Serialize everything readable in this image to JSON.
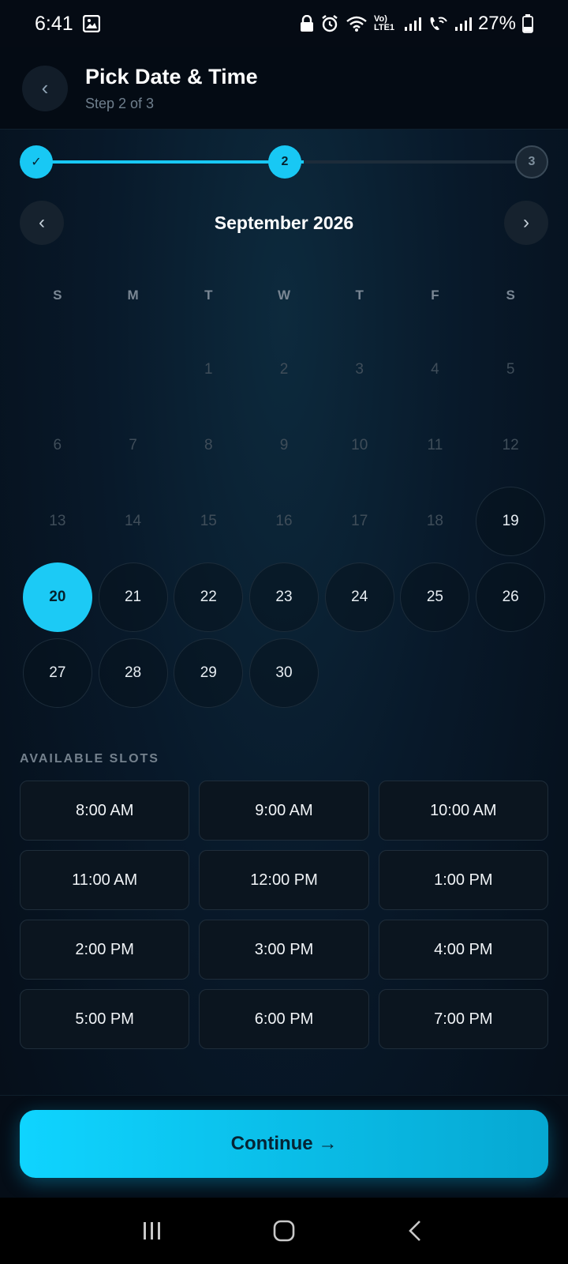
{
  "status_bar": {
    "time": "6:41",
    "battery": "27%",
    "network_label": "Vo) LTE1"
  },
  "header": {
    "title": "Pick Date & Time",
    "subtitle": "Step 2 of 3"
  },
  "stepper": {
    "steps": [
      {
        "label": "✓",
        "state": "done"
      },
      {
        "label": "2",
        "state": "current"
      },
      {
        "label": "3",
        "state": "upcoming"
      }
    ]
  },
  "calendar": {
    "month_label": "September 2026",
    "weekdays": [
      "S",
      "M",
      "T",
      "W",
      "T",
      "F",
      "S"
    ],
    "selected_day": "20",
    "days": [
      {
        "d": "",
        "s": "empty"
      },
      {
        "d": "",
        "s": "empty"
      },
      {
        "d": "1",
        "s": "disabled"
      },
      {
        "d": "2",
        "s": "disabled"
      },
      {
        "d": "3",
        "s": "disabled"
      },
      {
        "d": "4",
        "s": "disabled"
      },
      {
        "d": "5",
        "s": "disabled"
      },
      {
        "d": "6",
        "s": "disabled"
      },
      {
        "d": "7",
        "s": "disabled"
      },
      {
        "d": "8",
        "s": "disabled"
      },
      {
        "d": "9",
        "s": "disabled"
      },
      {
        "d": "10",
        "s": "disabled"
      },
      {
        "d": "11",
        "s": "disabled"
      },
      {
        "d": "12",
        "s": "disabled"
      },
      {
        "d": "13",
        "s": "disabled"
      },
      {
        "d": "14",
        "s": "disabled"
      },
      {
        "d": "15",
        "s": "disabled"
      },
      {
        "d": "16",
        "s": "disabled"
      },
      {
        "d": "17",
        "s": "disabled"
      },
      {
        "d": "18",
        "s": "disabled"
      },
      {
        "d": "19",
        "s": "available"
      },
      {
        "d": "20",
        "s": "selected"
      },
      {
        "d": "21",
        "s": "available"
      },
      {
        "d": "22",
        "s": "available"
      },
      {
        "d": "23",
        "s": "available"
      },
      {
        "d": "24",
        "s": "available"
      },
      {
        "d": "25",
        "s": "available"
      },
      {
        "d": "26",
        "s": "available"
      },
      {
        "d": "27",
        "s": "available"
      },
      {
        "d": "28",
        "s": "available"
      },
      {
        "d": "29",
        "s": "available"
      },
      {
        "d": "30",
        "s": "available"
      }
    ]
  },
  "slots": {
    "label": "AVAILABLE SLOTS",
    "times": [
      "8:00 AM",
      "9:00 AM",
      "10:00 AM",
      "11:00 AM",
      "12:00 PM",
      "1:00 PM",
      "2:00 PM",
      "3:00 PM",
      "4:00 PM",
      "5:00 PM",
      "6:00 PM",
      "7:00 PM"
    ]
  },
  "footer": {
    "continue_label": "Continue →"
  },
  "colors": {
    "accent": "#18c8f4",
    "background": "#08192a"
  }
}
